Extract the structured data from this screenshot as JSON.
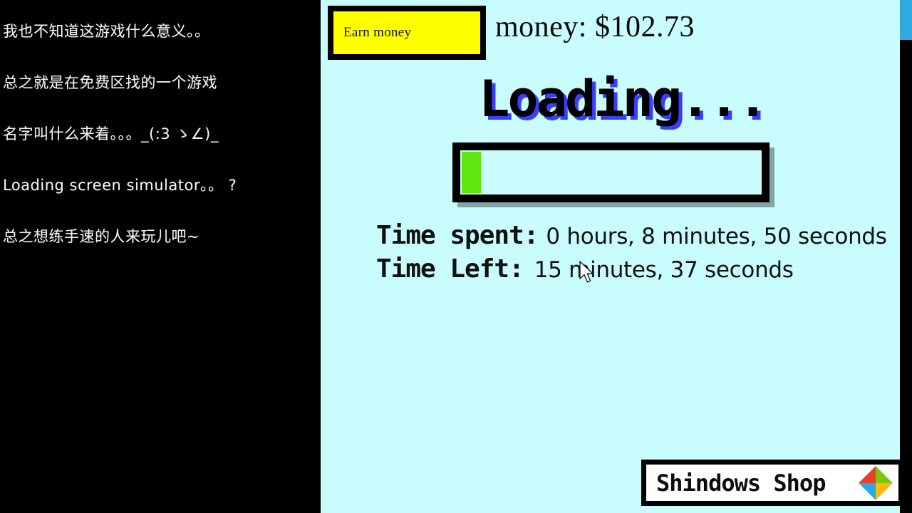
{
  "commentary": {
    "lines": [
      "我也不知道这游戏什么意义。。",
      "总之就是在免费区找的一个游戏",
      "名字叫什么来着。。。_(:3 ゝ∠)_",
      "Loading screen simulator。。 ?",
      "总之想练手速的人来玩儿吧~"
    ]
  },
  "game": {
    "earn_money_label": "Earn money",
    "money_readout": "money: $102.73",
    "loading_title": "Loading...",
    "progress_percent": 6.5,
    "time_spent": {
      "label": "Time spent:",
      "value": "0 hours, 8 minutes, 50 seconds"
    },
    "time_left": {
      "label": "Time Left:",
      "value": "15 minutes, 37 seconds"
    },
    "shop_label": "Shindows Shop"
  },
  "colors": {
    "game_background": "#c9fcfc",
    "panel_background": "#000000",
    "button_yellow": "#ffff00",
    "progress_green": "#5ee611",
    "loading_shadow_blue": "#3c3cff",
    "scrollbar_thumb": "#33aadd",
    "logo_red": "#e8402a",
    "logo_green": "#7ac70c",
    "logo_blue": "#29abe2",
    "logo_yellow": "#fcb813"
  }
}
